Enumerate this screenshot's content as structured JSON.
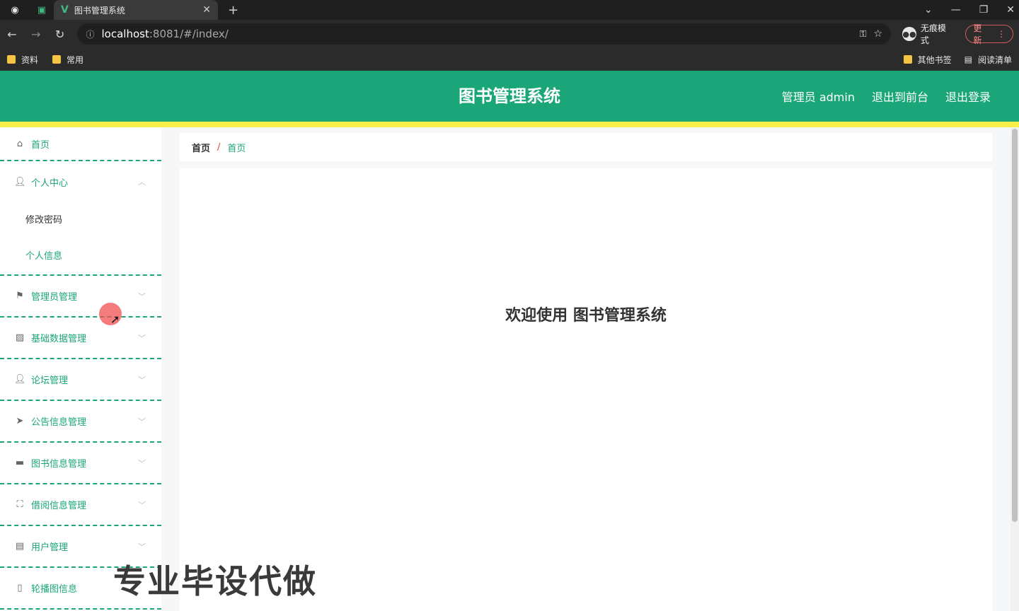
{
  "browser": {
    "tab_title": "图书管理系统",
    "url_host": "localhost",
    "url_path": ":8081/#/index/",
    "incognito_label": "无痕模式",
    "update_label": "更新",
    "bookmarks": [
      "资料",
      "常用"
    ],
    "other_bookmarks": "其他书签",
    "reading_list": "阅读清单"
  },
  "header": {
    "title": "图书管理系统",
    "admin_label": "管理员 admin",
    "to_front": "退出到前台",
    "logout": "退出登录"
  },
  "sidebar": {
    "home": "首页",
    "personal_center": "个人中心",
    "change_password": "修改密码",
    "personal_info": "个人信息",
    "items": [
      {
        "label": "管理员管理",
        "icon": "flag-icon"
      },
      {
        "label": "基础数据管理",
        "icon": "chart-icon"
      },
      {
        "label": "论坛管理",
        "icon": "user-icon"
      },
      {
        "label": "公告信息管理",
        "icon": "send-icon"
      },
      {
        "label": "图书信息管理",
        "icon": "briefcase-icon"
      },
      {
        "label": "借阅信息管理",
        "icon": "frame-icon"
      },
      {
        "label": "用户管理",
        "icon": "clipboard-icon"
      },
      {
        "label": "轮播图信息",
        "icon": "mobile-icon"
      }
    ]
  },
  "breadcrumb": {
    "root": "首页",
    "separator": "/",
    "current": "首页"
  },
  "main": {
    "welcome": "欢迎使用 图书管理系统"
  },
  "overlay": {
    "watermark": "专业毕设代做"
  },
  "colors": {
    "primary": "#1aa679",
    "accent_line": "#f6ef4a"
  }
}
